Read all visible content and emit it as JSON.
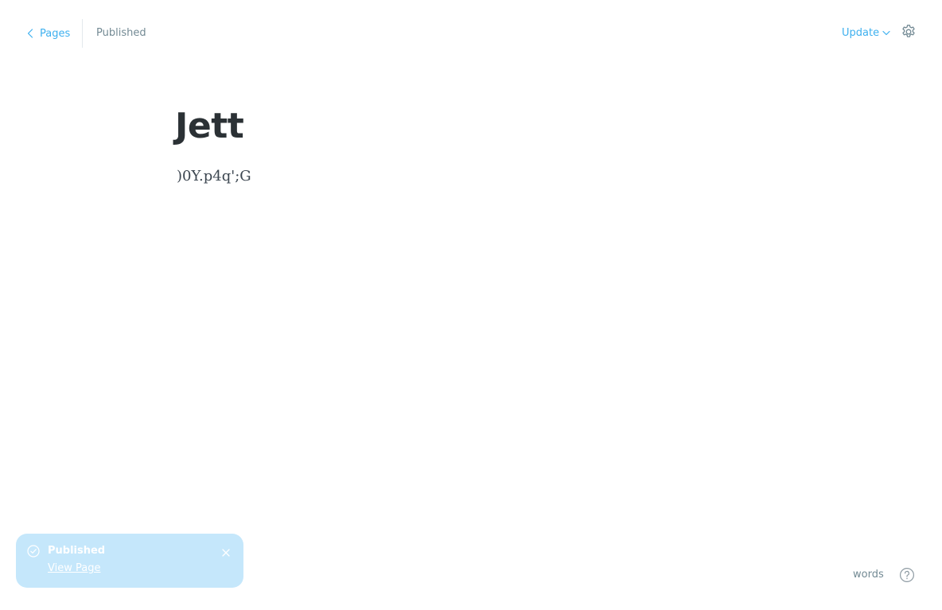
{
  "header": {
    "back_label": "Pages",
    "status": "Published",
    "update_label": "Update"
  },
  "editor": {
    "title": "Jett",
    "body": ")0Y.p4q';G"
  },
  "toast": {
    "title": "Published",
    "link_label": "View Page"
  },
  "footer": {
    "word_count_label": "words"
  },
  "icons": {
    "back": "chevron-left-icon",
    "update_dropdown": "chevron-down-icon",
    "settings": "gear-icon",
    "toast_status": "check-circle-icon",
    "toast_close": "close-icon",
    "help": "question-circle-icon"
  },
  "colors": {
    "accent": "#3eb0ef",
    "toast_background": "#c5e7fb",
    "muted_text": "#738a94",
    "title_text": "#2b3135"
  }
}
